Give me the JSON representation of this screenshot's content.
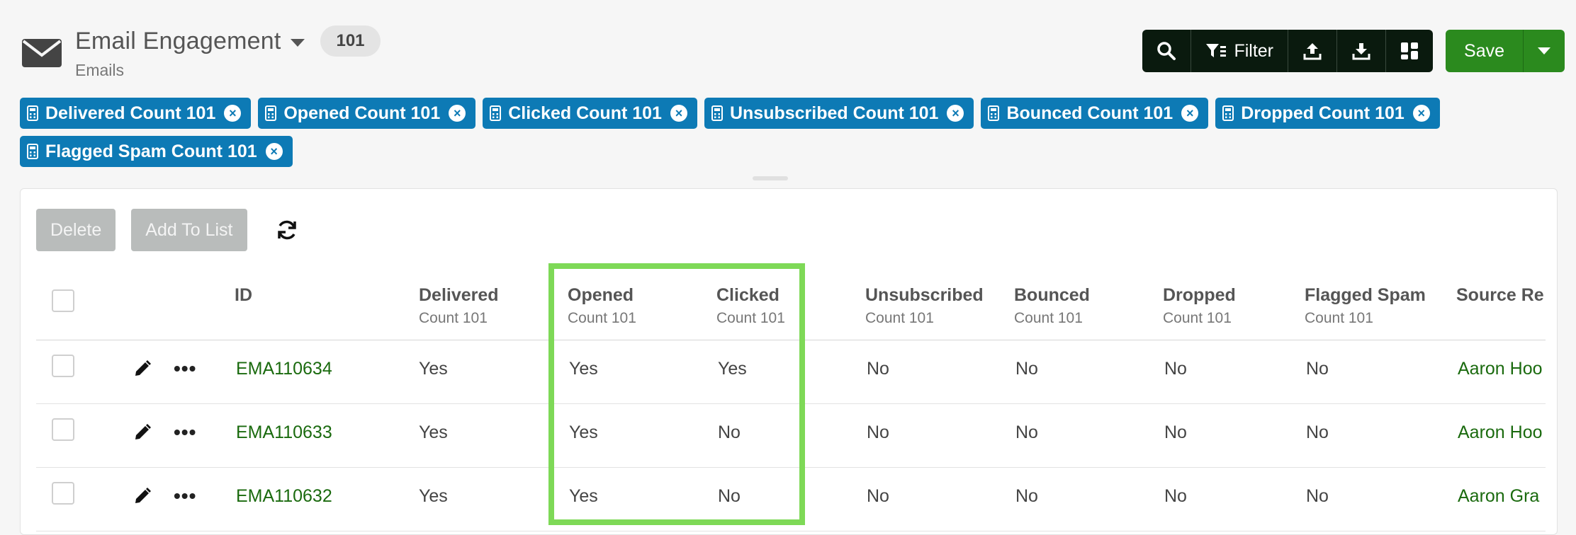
{
  "header": {
    "title": "Email Engagement",
    "count": "101",
    "subtitle": "Emails",
    "icon": "envelope-icon"
  },
  "toolbar": {
    "filter_label": "Filter",
    "save_label": "Save"
  },
  "chips": [
    {
      "label": "Delivered Count 101"
    },
    {
      "label": "Opened Count 101"
    },
    {
      "label": "Clicked Count 101"
    },
    {
      "label": "Unsubscribed Count 101"
    },
    {
      "label": "Bounced Count 101"
    },
    {
      "label": "Dropped Count 101"
    },
    {
      "label": "Flagged Spam Count 101"
    }
  ],
  "actions": {
    "delete_label": "Delete",
    "add_to_list_label": "Add To List"
  },
  "table": {
    "columns": [
      {
        "title": "ID",
        "sub": ""
      },
      {
        "title": "Delivered",
        "sub": "Count 101"
      },
      {
        "title": "Opened",
        "sub": "Count 101"
      },
      {
        "title": "Clicked",
        "sub": "Count 101"
      },
      {
        "title": "Unsubscribed",
        "sub": "Count 101"
      },
      {
        "title": "Bounced",
        "sub": "Count 101"
      },
      {
        "title": "Dropped",
        "sub": "Count 101"
      },
      {
        "title": "Flagged Spam",
        "sub": "Count 101"
      },
      {
        "title": "Source Re",
        "sub": ""
      }
    ],
    "rows": [
      {
        "id": "EMA110634",
        "delivered": "Yes",
        "opened": "Yes",
        "clicked": "Yes",
        "unsubscribed": "No",
        "bounced": "No",
        "dropped": "No",
        "flagged": "No",
        "source": "Aaron Hoo"
      },
      {
        "id": "EMA110633",
        "delivered": "Yes",
        "opened": "Yes",
        "clicked": "No",
        "unsubscribed": "No",
        "bounced": "No",
        "dropped": "No",
        "flagged": "No",
        "source": "Aaron Hoo"
      },
      {
        "id": "EMA110632",
        "delivered": "Yes",
        "opened": "Yes",
        "clicked": "No",
        "unsubscribed": "No",
        "bounced": "No",
        "dropped": "No",
        "flagged": "No",
        "source": "Aaron Gra"
      }
    ]
  },
  "colors": {
    "chip": "#0d7ab5",
    "save": "#2b8a1e",
    "toolbar": "#0a1a0e",
    "link": "#1a6a0e",
    "highlight": "#7ed957"
  }
}
